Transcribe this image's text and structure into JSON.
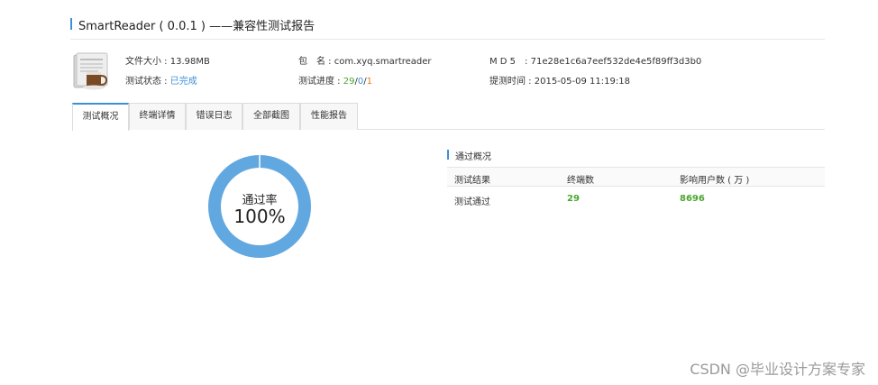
{
  "header": {
    "title": "SmartReader ( 0.0.1 ) ——兼容性测试报告"
  },
  "app_info": {
    "file_size_label": "文件大小 : ",
    "file_size_value": "13.98MB",
    "package_label": "包　名 : ",
    "package_value": "com.xyq.smartreader",
    "md5_label": "M D 5　: ",
    "md5_value": "71e28e1c6a7eef532de4e5f89ff3d3b0",
    "status_label": "测试状态 : ",
    "status_value": "已完成",
    "progress_label": "测试进度 : ",
    "progress_passed": "29",
    "progress_sep1": "/",
    "progress_failed": "0",
    "progress_sep2": "/",
    "progress_total": "1",
    "submit_time_label": "提测时间 : ",
    "submit_time_value": "2015-05-09 11:19:18"
  },
  "tabs": [
    {
      "label": "测试概况",
      "active": true
    },
    {
      "label": "终端详情",
      "active": false
    },
    {
      "label": "错误日志",
      "active": false
    },
    {
      "label": "全部截图",
      "active": false
    },
    {
      "label": "性能报告",
      "active": false
    }
  ],
  "pass_chart": {
    "label": "通过率",
    "value_text": "100%",
    "pass_fraction": 1.0,
    "color": "#62a8e0"
  },
  "summary": {
    "title": "通过概况",
    "headers": [
      "测试结果",
      "终端数",
      "影响用户数 ( 万 )"
    ],
    "rows": [
      {
        "result": "测试通过",
        "devices": "29",
        "users": "8696"
      }
    ]
  },
  "watermark": "CSDN @毕业设计方案专家",
  "colors": {
    "accent": "#3f8fd8",
    "green": "#4aa62e",
    "orange": "#e0781a"
  }
}
